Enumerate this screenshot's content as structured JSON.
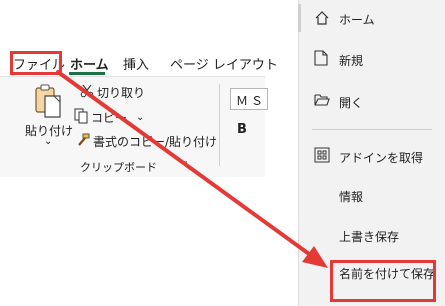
{
  "ribbon": {
    "tabs": [
      "ファイル",
      "ホーム",
      "挿入",
      "ページ レイアウト"
    ],
    "clipboard": {
      "paste_label": "貼り付け",
      "cut_label": "切り取り",
      "copy_label": "コピー",
      "format_painter_label": "書式のコピー/貼り付け",
      "group_label": "クリップボード"
    },
    "font": {
      "font_box_value": "ＭＳ",
      "bold_label": "B"
    }
  },
  "backstage": {
    "home_label": "ホーム",
    "new_label": "新規",
    "open_label": "開く",
    "addins_label": "アドインを取得",
    "info_label": "情報",
    "save_label": "上書き保存",
    "saveas_label": "名前を付けて保存"
  },
  "annotation": {
    "highlight_color": "#e53935"
  }
}
